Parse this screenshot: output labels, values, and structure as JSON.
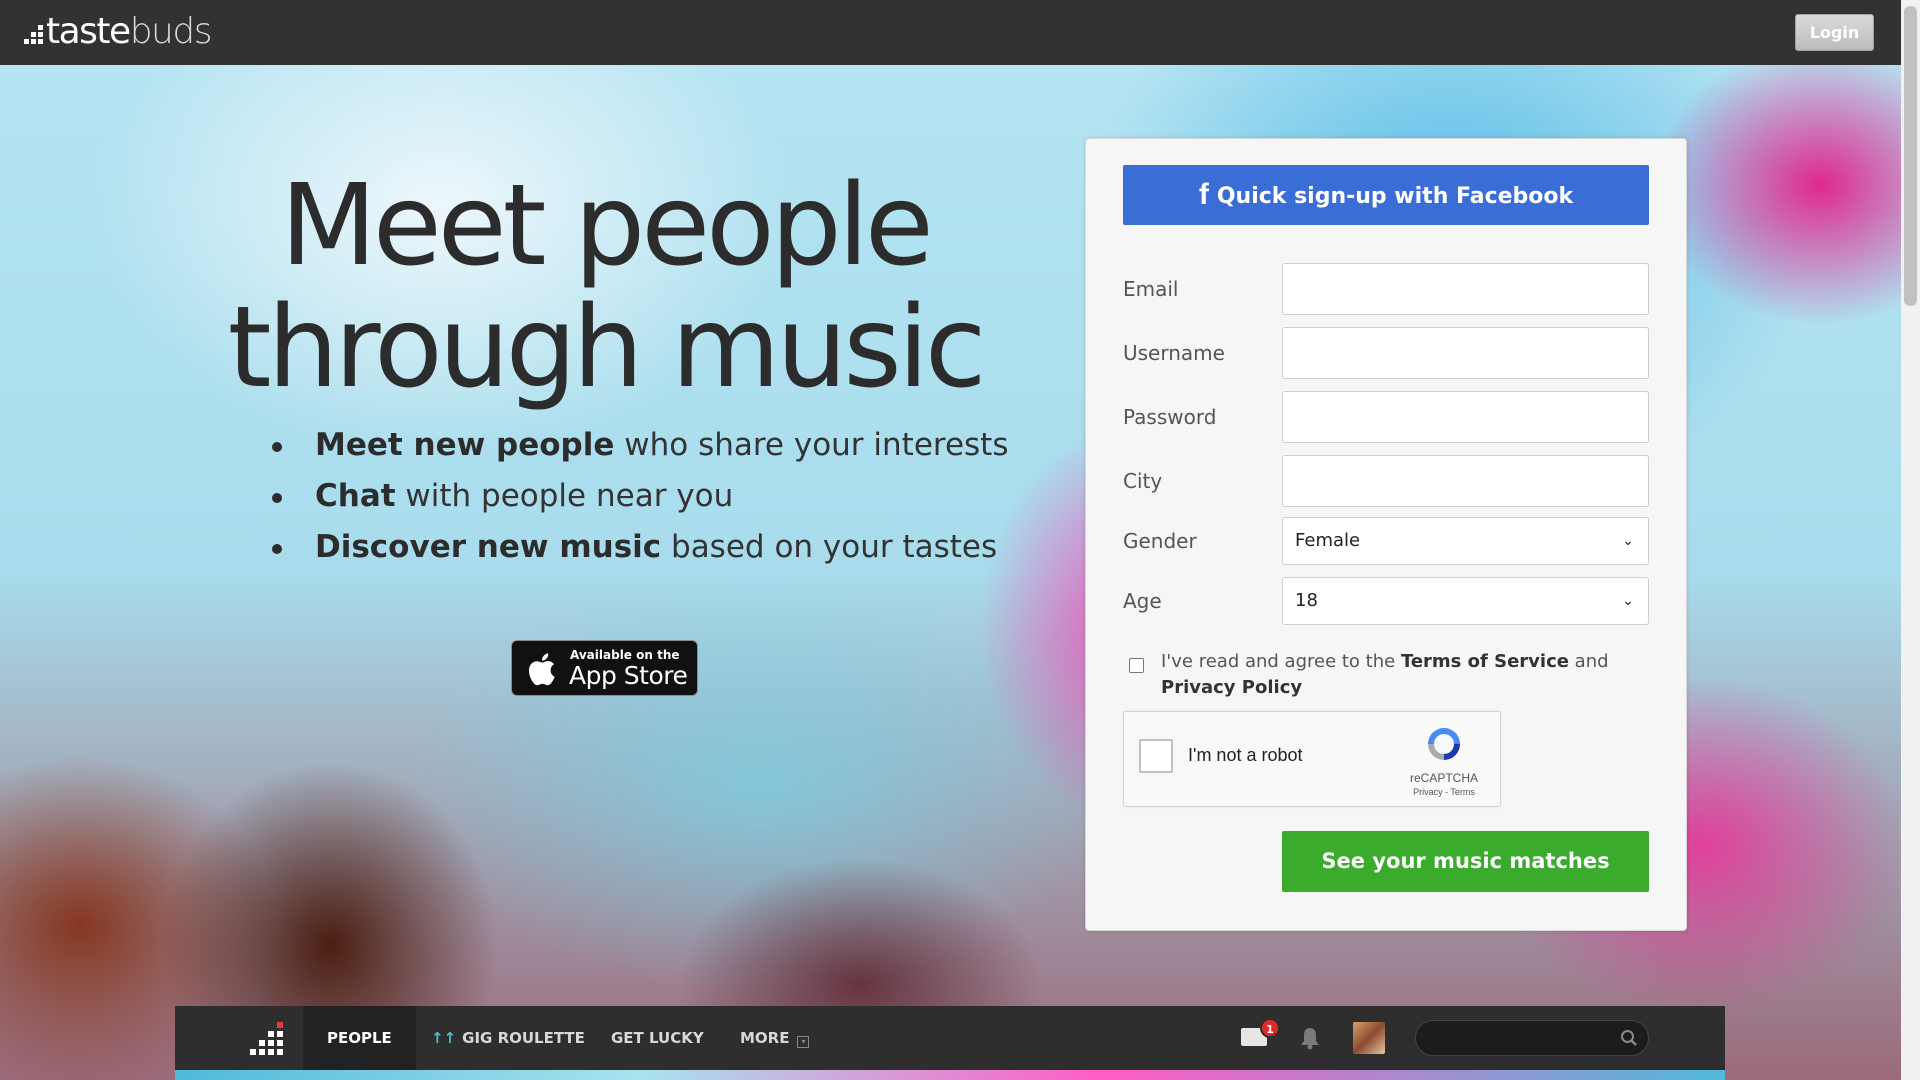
{
  "header": {
    "logo_bold": "taste",
    "logo_light": "buds",
    "login_label": "Login"
  },
  "hero": {
    "headline_line1": "Meet people",
    "headline_line2": "through music",
    "features": [
      {
        "bold": "Meet new people",
        "rest": " who share your interests"
      },
      {
        "bold": "Chat",
        "rest": " with people near you"
      },
      {
        "bold": "Discover new music",
        "rest": " based on your tastes"
      }
    ],
    "appstore": {
      "small": "Available on the",
      "big": "App Store",
      "icon": "apple-icon"
    }
  },
  "signup": {
    "facebook_label": "Quick sign-up with Facebook",
    "facebook_glyph": "f",
    "fields": {
      "email": {
        "label": "Email",
        "value": ""
      },
      "username": {
        "label": "Username",
        "value": ""
      },
      "password": {
        "label": "Password",
        "value": ""
      },
      "city": {
        "label": "City",
        "value": ""
      }
    },
    "gender": {
      "label": "Gender",
      "selected": "Female"
    },
    "age": {
      "label": "Age",
      "selected": "18"
    },
    "agree": {
      "prefix": "I've read and agree to the ",
      "terms": "Terms of Service",
      "and": " and ",
      "privacy": "Privacy Policy"
    },
    "captcha": {
      "label": "I'm not a robot",
      "brand": "reCAPTCHA",
      "links": "Privacy - Terms"
    },
    "submit_label": "See your music matches"
  },
  "preview_nav": {
    "tabs": [
      "PEOPLE",
      "GIG ROULETTE",
      "GET LUCKY",
      "MORE"
    ],
    "messages_badge": "1",
    "icons": [
      "messages-icon",
      "bell-icon",
      "avatar",
      "search-icon"
    ]
  },
  "colors": {
    "topbar": "#323232",
    "facebook": "#3b6dd6",
    "submit": "#3aab2d",
    "badge": "#e02a2a"
  }
}
